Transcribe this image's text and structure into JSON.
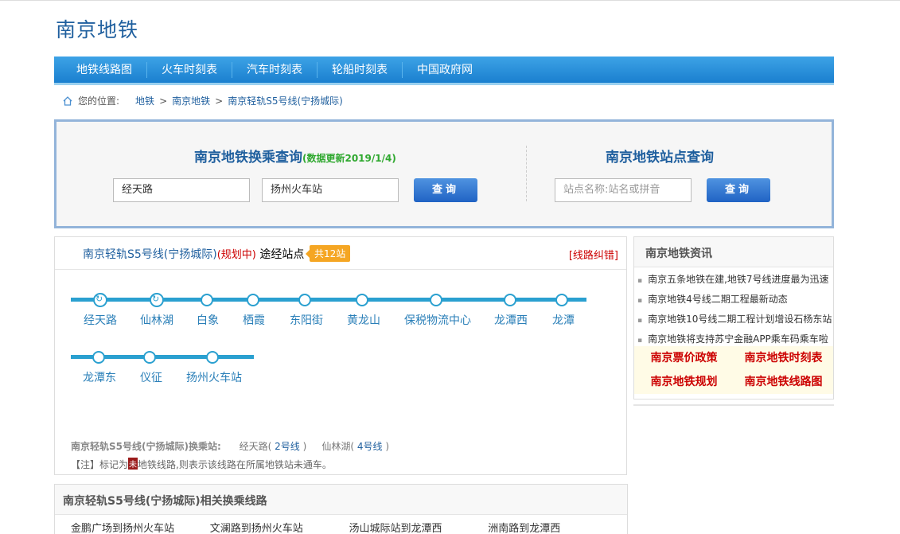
{
  "site": {
    "brand": "南京地铁"
  },
  "nav": [
    "地铁线路图",
    "火车时刻表",
    "汽车时刻表",
    "轮船时刻表",
    "中国政府网"
  ],
  "breadcrumb": {
    "label": "您的位置:",
    "items": [
      "地铁",
      "南京地铁",
      "南京轻轨S5号线(宁扬城际)"
    ],
    "sep": ">"
  },
  "transfer_search": {
    "title": "南京地铁换乘查询",
    "update": "(数据更新2019/1/4)",
    "from_value": "经天路",
    "to_value": "扬州火车站",
    "button": "查询"
  },
  "station_search": {
    "title": "南京地铁站点查询",
    "placeholder": "站点名称:站名或拼音",
    "button": "查询"
  },
  "line": {
    "name": "南京轻轨S5号线(宁扬城际)",
    "status": "(规划中)",
    "via": "途经站点",
    "count": "共12站",
    "fix": "[线路纠错]",
    "stations_row1": [
      "经天路",
      "仙林湖",
      "白象",
      "栖霞",
      "东阳街",
      "黄龙山",
      "保税物流中心",
      "龙潭西",
      "龙潭"
    ],
    "stations_row2": [
      "龙潭东",
      "仪征",
      "扬州火车站"
    ],
    "transfer_label": "南京轻轨S5号线(宁扬城际)换乘站:",
    "transfers": [
      {
        "station": "经天路(",
        "line": "2号线",
        "close": ")"
      },
      {
        "station": "仙林湖(",
        "line": "4号线",
        "close": ")"
      }
    ],
    "note_prefix": "【注】标记为",
    "note_mark": "未",
    "note_suffix": "地铁线路,则表示该线路在所属地铁站未通车。"
  },
  "news": {
    "title": "南京地铁资讯",
    "items": [
      "南京五条地铁在建,地铁7号线进度最为迅速",
      "南京地铁4号线二期工程最新动态",
      "南京地铁10号线二期工程计划增设石杨东站",
      "南京地铁将支持苏宁金融APP乘车码乘车啦"
    ],
    "links": [
      "南京票价政策",
      "南京地铁时刻表",
      "南京地铁规划",
      "南京地铁线路图"
    ]
  },
  "related": {
    "title": "南京轻轨S5号线(宁扬城际)相关换乘线路",
    "items": [
      "金鹏广场到扬州火车站",
      "文澜路到扬州火车站",
      "汤山城际站到龙潭西",
      "洲南路到龙潭西"
    ]
  }
}
